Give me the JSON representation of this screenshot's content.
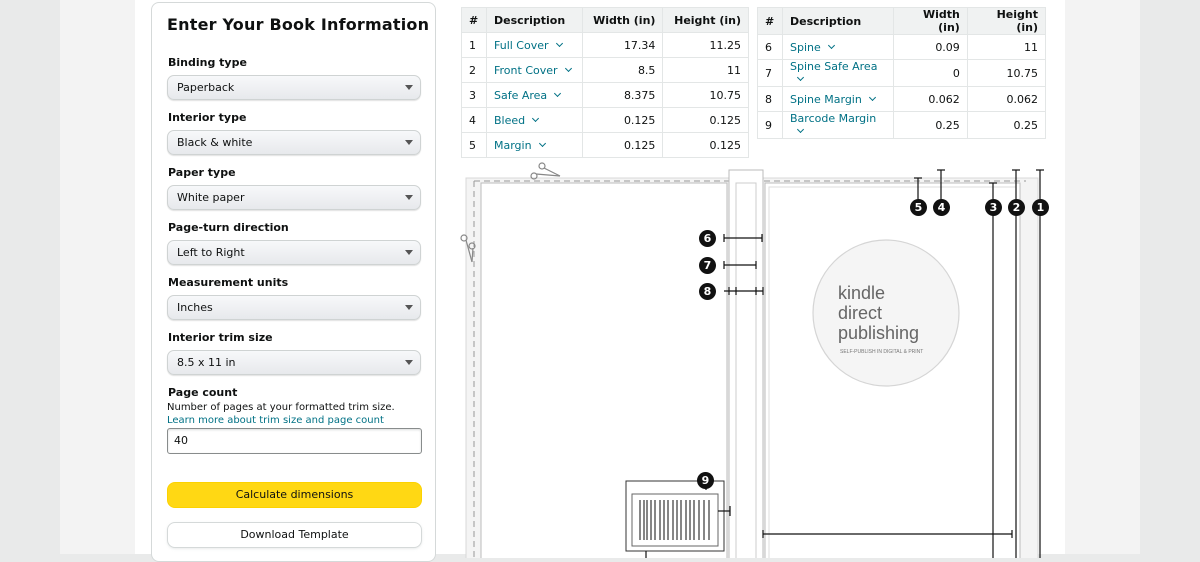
{
  "form": {
    "title": "Enter Your Book Information",
    "fields": [
      {
        "label": "Binding type",
        "value": "Paperback"
      },
      {
        "label": "Interior type",
        "value": "Black & white"
      },
      {
        "label": "Paper type",
        "value": "White paper"
      },
      {
        "label": "Page-turn direction",
        "value": "Left to Right"
      },
      {
        "label": "Measurement units",
        "value": "Inches"
      },
      {
        "label": "Interior trim size",
        "value": "8.5 x 11 in"
      }
    ],
    "page_count": {
      "label": "Page count",
      "help": "Number of pages at your formatted trim size.",
      "link": "Learn more about trim size and page count",
      "value": "40"
    },
    "calculate_label": "Calculate dimensions",
    "download_label": "Download Template"
  },
  "table": {
    "headers": [
      "#",
      "Description",
      "Width (in)",
      "Height (in)"
    ],
    "left_rows": [
      {
        "num": "1",
        "desc": "Full Cover",
        "width": "17.34",
        "height": "11.25"
      },
      {
        "num": "2",
        "desc": "Front Cover",
        "width": "8.5",
        "height": "11"
      },
      {
        "num": "3",
        "desc": "Safe Area",
        "width": "8.375",
        "height": "10.75"
      },
      {
        "num": "4",
        "desc": "Bleed",
        "width": "0.125",
        "height": "0.125"
      },
      {
        "num": "5",
        "desc": "Margin",
        "width": "0.125",
        "height": "0.125"
      }
    ],
    "right_rows": [
      {
        "num": "6",
        "desc": "Spine",
        "width": "0.09",
        "height": "11"
      },
      {
        "num": "7",
        "desc": "Spine Safe Area",
        "width": "0",
        "height": "10.75"
      },
      {
        "num": "8",
        "desc": "Spine Margin",
        "width": "0.062",
        "height": "0.062"
      },
      {
        "num": "9",
        "desc": "Barcode Margin",
        "width": "0.25",
        "height": "0.25"
      }
    ]
  },
  "diagram": {
    "logo_line1": "kindle",
    "logo_line2": "direct",
    "logo_line3": "publishing",
    "logo_tagline": "SELF-PUBLISH IN DIGITAL & PRINT",
    "badges": [
      "1",
      "2",
      "3",
      "4",
      "5",
      "6",
      "7",
      "8",
      "9"
    ]
  }
}
